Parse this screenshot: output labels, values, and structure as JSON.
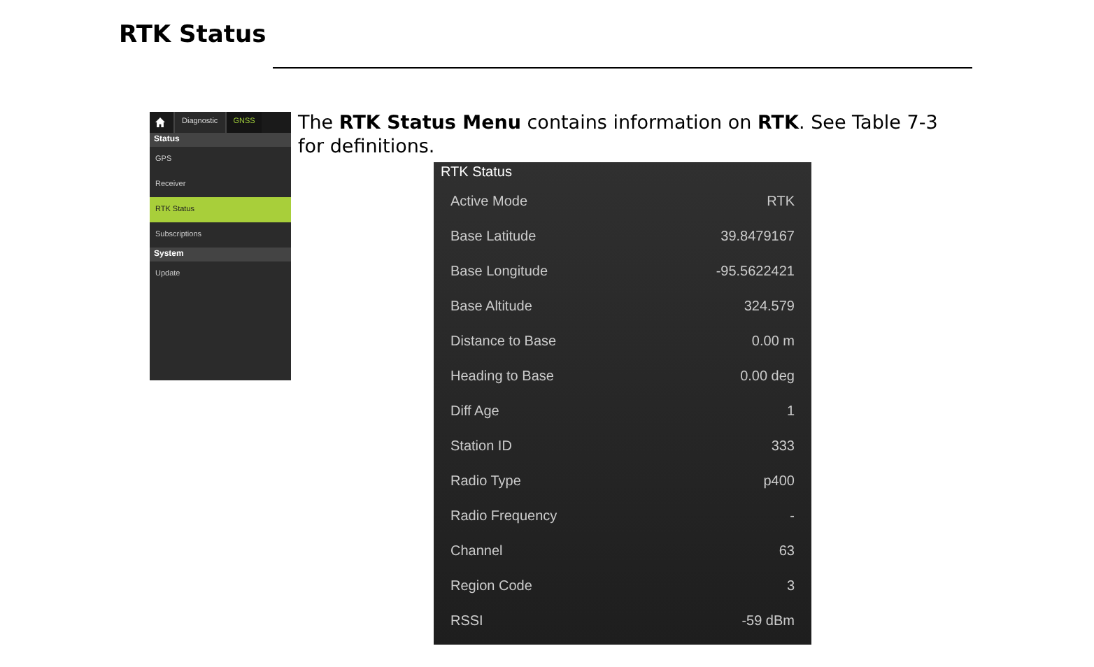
{
  "heading": "RTK Status",
  "menu": {
    "breadcrumb": [
      {
        "label": "Diagnostic",
        "selected": false
      },
      {
        "label": "GNSS",
        "selected": true
      }
    ],
    "sections": [
      {
        "title": "Status",
        "items": [
          {
            "label": "GPS",
            "selected": false
          },
          {
            "label": "Receiver",
            "selected": false
          },
          {
            "label": "RTK Status",
            "selected": true
          },
          {
            "label": "Subscriptions",
            "selected": false
          }
        ]
      },
      {
        "title": "System",
        "items": [
          {
            "label": "Update",
            "selected": false
          }
        ]
      }
    ]
  },
  "paragraph": "The **RTK Status Menu** contains information on **RTK**. See Table 7-3 for definitions.",
  "panel": {
    "title": "RTK Status",
    "rows": [
      {
        "label": "Active Mode",
        "value": "RTK"
      },
      {
        "label": "Base Latitude",
        "value": "39.8479167"
      },
      {
        "label": "Base Longitude",
        "value": "-95.5622421"
      },
      {
        "label": "Base Altitude",
        "value": "324.579"
      },
      {
        "label": "Distance to Base",
        "value": "0.00 m"
      },
      {
        "label": "Heading to Base",
        "value": "0.00 deg"
      },
      {
        "label": "Diff Age",
        "value": "1"
      },
      {
        "label": "Station ID",
        "value": "333"
      },
      {
        "label": "Radio Type",
        "value": "p400"
      },
      {
        "label": "Radio Frequency",
        "value": "-"
      },
      {
        "label": "Channel",
        "value": "63"
      },
      {
        "label": "Region Code",
        "value": "3"
      },
      {
        "label": "RSSI",
        "value": "-59 dBm"
      }
    ]
  }
}
